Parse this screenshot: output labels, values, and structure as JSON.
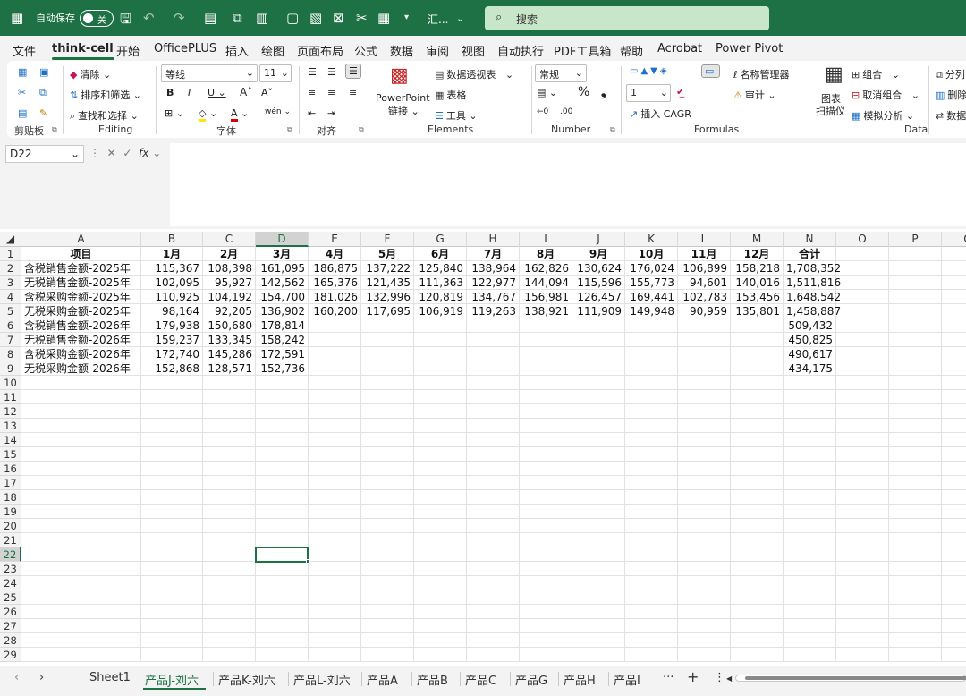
{
  "title_bar": {
    "autosave_label": "自动保存",
    "autosave_state": "关",
    "workbook_name": "汇...",
    "search_placeholder": "搜索",
    "brand_color": "#1e7145"
  },
  "menu": {
    "tabs": [
      "文件",
      "think-cell",
      "开始",
      "OfficePLUS",
      "插入",
      "绘图",
      "页面布局",
      "公式",
      "数据",
      "审阅",
      "视图",
      "自动执行",
      "PDF工具箱",
      "帮助",
      "Acrobat",
      "Power Pivot"
    ],
    "active": "think-cell"
  },
  "ribbon": {
    "clear": "清除",
    "sort_filter": "排序和筛选",
    "find_select": "查找和选择",
    "editing_label": "Editing",
    "clipboard_label": "剪贴板",
    "font_name": "等线",
    "font_size": "11",
    "font_label": "字体",
    "align_label": "对齐",
    "ppt_line1": "PowerPoint",
    "ppt_line2": "链接",
    "pivot": "数据透视表",
    "table": "表格",
    "tools": "工具",
    "elements_label": "Elements",
    "number_format": "常规",
    "number_label": "Number",
    "decimals": "1",
    "insert_cagr": "插入 CAGR",
    "name_manager": "名称管理器",
    "audit": "审计",
    "formulas_label": "Formulas",
    "chart_scanner_1": "图表",
    "chart_scanner_2": "扫描仪",
    "group": "组合",
    "ungroup": "取消组合",
    "what_if": "模拟分析",
    "data_label": "Data",
    "split": "分列",
    "delete": "删除",
    "data_more": "数据"
  },
  "formula_bar": {
    "name_box": "D22",
    "fx": "fx",
    "content": ""
  },
  "sheet": {
    "columns": [
      "A",
      "B",
      "C",
      "D",
      "E",
      "F",
      "G",
      "H",
      "I",
      "J",
      "K",
      "L",
      "M",
      "N",
      "O",
      "P",
      "Q"
    ],
    "selected_column": "D",
    "selected_row": 22,
    "row_count": 29,
    "header": [
      "项目",
      "1月",
      "2月",
      "3月",
      "4月",
      "5月",
      "6月",
      "7月",
      "8月",
      "9月",
      "10月",
      "11月",
      "12月",
      "合计"
    ],
    "rows": [
      [
        "含税销售金额-2025年",
        "115,367",
        "108,398",
        "161,095",
        "186,875",
        "137,222",
        "125,840",
        "138,964",
        "162,826",
        "130,624",
        "176,024",
        "106,899",
        "158,218",
        "1,708,352"
      ],
      [
        "无税销售金额-2025年",
        "102,095",
        "95,927",
        "142,562",
        "165,376",
        "121,435",
        "111,363",
        "122,977",
        "144,094",
        "115,596",
        "155,773",
        "94,601",
        "140,016",
        "1,511,816"
      ],
      [
        "含税采购金额-2025年",
        "110,925",
        "104,192",
        "154,700",
        "181,026",
        "132,996",
        "120,819",
        "134,767",
        "156,981",
        "126,457",
        "169,441",
        "102,783",
        "153,456",
        "1,648,542"
      ],
      [
        "无税采购金额-2025年",
        "98,164",
        "92,205",
        "136,902",
        "160,200",
        "117,695",
        "106,919",
        "119,263",
        "138,921",
        "111,909",
        "149,948",
        "90,959",
        "135,801",
        "1,458,887"
      ],
      [
        "含税销售金额-2026年",
        "179,938",
        "150,680",
        "178,814",
        "",
        "",
        "",
        "",
        "",
        "",
        "",
        "",
        "",
        "509,432"
      ],
      [
        "无税销售金额-2026年",
        "159,237",
        "133,345",
        "158,242",
        "",
        "",
        "",
        "",
        "",
        "",
        "",
        "",
        "",
        "450,825"
      ],
      [
        "含税采购金额-2026年",
        "172,740",
        "145,286",
        "172,591",
        "",
        "",
        "",
        "",
        "",
        "",
        "",
        "",
        "",
        "490,617"
      ],
      [
        "无税采购金额-2026年",
        "152,868",
        "128,571",
        "152,736",
        "",
        "",
        "",
        "",
        "",
        "",
        "",
        "",
        "",
        "434,175"
      ]
    ]
  },
  "sheet_tabs": {
    "tabs": [
      "Sheet1",
      "产品J-刘六",
      "产品K-刘六",
      "产品L-刘六",
      "产品A",
      "产品B",
      "产品C",
      "产品G",
      "产品H",
      "产品I"
    ],
    "active": "产品J-刘六",
    "more": "···",
    "add": "+"
  }
}
